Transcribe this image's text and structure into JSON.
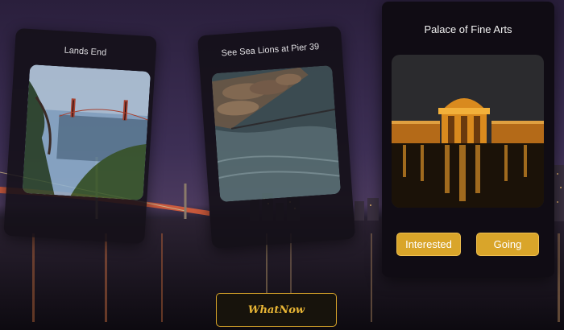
{
  "brand_color": "#d9a52a",
  "cards": [
    {
      "title": "Lands End",
      "image": "golden-gate-coast-photo"
    },
    {
      "title": "See Sea Lions at Pier 39",
      "image": "sea-lions-photo"
    },
    {
      "title": "Palace of Fine Arts",
      "image": "palace-of-fine-arts-photo",
      "interested_label": "Interested",
      "going_label": "Going"
    }
  ],
  "footer": {
    "whatnow_label": "WhatNow"
  }
}
